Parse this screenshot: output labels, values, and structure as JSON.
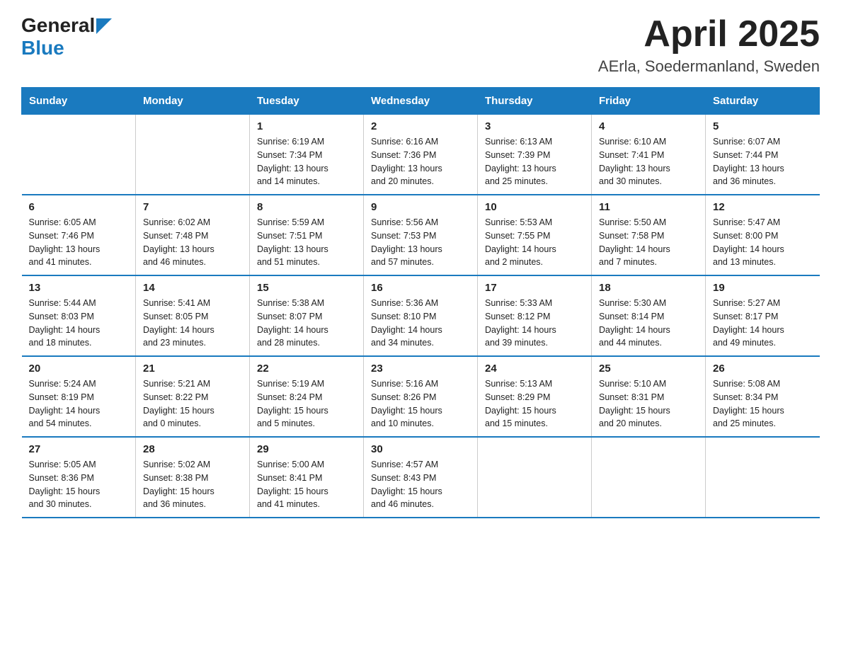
{
  "header": {
    "logo_general": "General",
    "logo_blue": "Blue",
    "title": "April 2025",
    "subtitle": "AErla, Soedermanland, Sweden"
  },
  "days_of_week": [
    "Sunday",
    "Monday",
    "Tuesday",
    "Wednesday",
    "Thursday",
    "Friday",
    "Saturday"
  ],
  "weeks": [
    [
      {
        "day": "",
        "info": ""
      },
      {
        "day": "",
        "info": ""
      },
      {
        "day": "1",
        "info": "Sunrise: 6:19 AM\nSunset: 7:34 PM\nDaylight: 13 hours\nand 14 minutes."
      },
      {
        "day": "2",
        "info": "Sunrise: 6:16 AM\nSunset: 7:36 PM\nDaylight: 13 hours\nand 20 minutes."
      },
      {
        "day": "3",
        "info": "Sunrise: 6:13 AM\nSunset: 7:39 PM\nDaylight: 13 hours\nand 25 minutes."
      },
      {
        "day": "4",
        "info": "Sunrise: 6:10 AM\nSunset: 7:41 PM\nDaylight: 13 hours\nand 30 minutes."
      },
      {
        "day": "5",
        "info": "Sunrise: 6:07 AM\nSunset: 7:44 PM\nDaylight: 13 hours\nand 36 minutes."
      }
    ],
    [
      {
        "day": "6",
        "info": "Sunrise: 6:05 AM\nSunset: 7:46 PM\nDaylight: 13 hours\nand 41 minutes."
      },
      {
        "day": "7",
        "info": "Sunrise: 6:02 AM\nSunset: 7:48 PM\nDaylight: 13 hours\nand 46 minutes."
      },
      {
        "day": "8",
        "info": "Sunrise: 5:59 AM\nSunset: 7:51 PM\nDaylight: 13 hours\nand 51 minutes."
      },
      {
        "day": "9",
        "info": "Sunrise: 5:56 AM\nSunset: 7:53 PM\nDaylight: 13 hours\nand 57 minutes."
      },
      {
        "day": "10",
        "info": "Sunrise: 5:53 AM\nSunset: 7:55 PM\nDaylight: 14 hours\nand 2 minutes."
      },
      {
        "day": "11",
        "info": "Sunrise: 5:50 AM\nSunset: 7:58 PM\nDaylight: 14 hours\nand 7 minutes."
      },
      {
        "day": "12",
        "info": "Sunrise: 5:47 AM\nSunset: 8:00 PM\nDaylight: 14 hours\nand 13 minutes."
      }
    ],
    [
      {
        "day": "13",
        "info": "Sunrise: 5:44 AM\nSunset: 8:03 PM\nDaylight: 14 hours\nand 18 minutes."
      },
      {
        "day": "14",
        "info": "Sunrise: 5:41 AM\nSunset: 8:05 PM\nDaylight: 14 hours\nand 23 minutes."
      },
      {
        "day": "15",
        "info": "Sunrise: 5:38 AM\nSunset: 8:07 PM\nDaylight: 14 hours\nand 28 minutes."
      },
      {
        "day": "16",
        "info": "Sunrise: 5:36 AM\nSunset: 8:10 PM\nDaylight: 14 hours\nand 34 minutes."
      },
      {
        "day": "17",
        "info": "Sunrise: 5:33 AM\nSunset: 8:12 PM\nDaylight: 14 hours\nand 39 minutes."
      },
      {
        "day": "18",
        "info": "Sunrise: 5:30 AM\nSunset: 8:14 PM\nDaylight: 14 hours\nand 44 minutes."
      },
      {
        "day": "19",
        "info": "Sunrise: 5:27 AM\nSunset: 8:17 PM\nDaylight: 14 hours\nand 49 minutes."
      }
    ],
    [
      {
        "day": "20",
        "info": "Sunrise: 5:24 AM\nSunset: 8:19 PM\nDaylight: 14 hours\nand 54 minutes."
      },
      {
        "day": "21",
        "info": "Sunrise: 5:21 AM\nSunset: 8:22 PM\nDaylight: 15 hours\nand 0 minutes."
      },
      {
        "day": "22",
        "info": "Sunrise: 5:19 AM\nSunset: 8:24 PM\nDaylight: 15 hours\nand 5 minutes."
      },
      {
        "day": "23",
        "info": "Sunrise: 5:16 AM\nSunset: 8:26 PM\nDaylight: 15 hours\nand 10 minutes."
      },
      {
        "day": "24",
        "info": "Sunrise: 5:13 AM\nSunset: 8:29 PM\nDaylight: 15 hours\nand 15 minutes."
      },
      {
        "day": "25",
        "info": "Sunrise: 5:10 AM\nSunset: 8:31 PM\nDaylight: 15 hours\nand 20 minutes."
      },
      {
        "day": "26",
        "info": "Sunrise: 5:08 AM\nSunset: 8:34 PM\nDaylight: 15 hours\nand 25 minutes."
      }
    ],
    [
      {
        "day": "27",
        "info": "Sunrise: 5:05 AM\nSunset: 8:36 PM\nDaylight: 15 hours\nand 30 minutes."
      },
      {
        "day": "28",
        "info": "Sunrise: 5:02 AM\nSunset: 8:38 PM\nDaylight: 15 hours\nand 36 minutes."
      },
      {
        "day": "29",
        "info": "Sunrise: 5:00 AM\nSunset: 8:41 PM\nDaylight: 15 hours\nand 41 minutes."
      },
      {
        "day": "30",
        "info": "Sunrise: 4:57 AM\nSunset: 8:43 PM\nDaylight: 15 hours\nand 46 minutes."
      },
      {
        "day": "",
        "info": ""
      },
      {
        "day": "",
        "info": ""
      },
      {
        "day": "",
        "info": ""
      }
    ]
  ]
}
